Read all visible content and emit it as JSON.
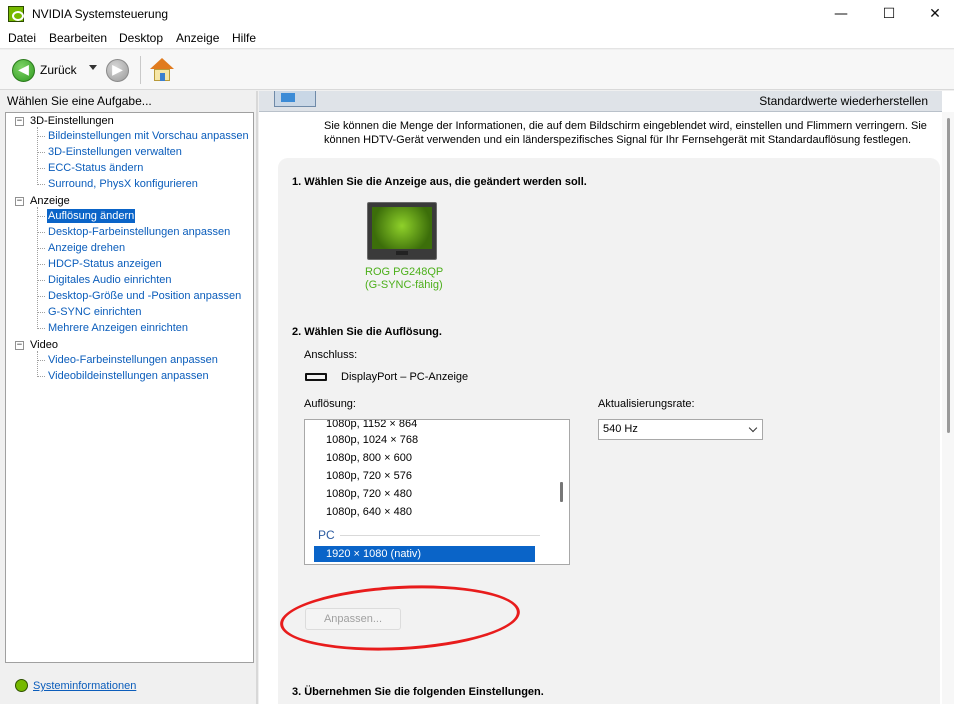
{
  "window": {
    "title": "NVIDIA Systemsteuerung",
    "minimize": "—",
    "maximize": "☐",
    "close": "✕"
  },
  "menu": [
    "Datei",
    "Bearbeiten",
    "Desktop",
    "Anzeige",
    "Hilfe"
  ],
  "toolbar": {
    "back_label": "Zurück",
    "back_arrow": "◀",
    "forward_arrow": "▶"
  },
  "sidebar": {
    "header": "Wählen Sie eine Aufgabe...",
    "groups": [
      {
        "label": "3D-Einstellungen",
        "toggle": "−",
        "items": [
          "Bildeinstellungen mit Vorschau anpassen",
          "3D-Einstellungen verwalten",
          "ECC-Status ändern",
          "Surround, PhysX konfigurieren"
        ]
      },
      {
        "label": "Anzeige",
        "toggle": "−",
        "items": [
          "Auflösung ändern",
          "Desktop-Farbeinstellungen anpassen",
          "Anzeige drehen",
          "HDCP-Status anzeigen",
          "Digitales Audio einrichten",
          "Desktop-Größe und -Position anpassen",
          "G-SYNC einrichten",
          "Mehrere Anzeigen einrichten"
        ]
      },
      {
        "label": "Video",
        "toggle": "−",
        "items": [
          "Video-Farbeinstellungen anpassen",
          "Videobildeinstellungen anpassen"
        ]
      }
    ],
    "selected": "Auflösung ändern",
    "system_info": "Systeminformationen"
  },
  "content": {
    "restore_defaults": "Standardwerte wiederherstellen",
    "description": "Sie können die Menge der Informationen, die auf dem Bildschirm eingeblendet wird, einstellen und Flimmern verringern. Sie können HDTV-Gerät verwenden und ein länderspezifisches Signal für Ihr Fernsehgerät mit Standardauflösung festlegen.",
    "step1": "1. Wählen Sie die Anzeige aus, die geändert werden soll.",
    "monitor": {
      "name": "ROG PG248QP",
      "subtitle": "(G-SYNC-fähig)"
    },
    "step2": "2. Wählen Sie die Auflösung.",
    "connector_label": "Anschluss:",
    "connector_value": "DisplayPort – PC-Anzeige",
    "resolution_label": "Auflösung:",
    "resolutions": [
      "1080p, 1152 × 864",
      "1080p, 1024 × 768",
      "1080p, 800 × 600",
      "1080p, 720 × 576",
      "1080p, 720 × 480",
      "1080p, 640 × 480"
    ],
    "pc_group": "PC",
    "selected_resolution": "1920 × 1080 (nativ)",
    "refresh_label": "Aktualisierungsrate:",
    "refresh_value": "540 Hz",
    "customize_button": "Anpassen...",
    "step3": "3. Übernehmen Sie die folgenden Einstellungen."
  },
  "colors": {
    "accent": "#0a64c8",
    "nvidia_green": "#76b900",
    "annotation": "#e81c1c"
  }
}
